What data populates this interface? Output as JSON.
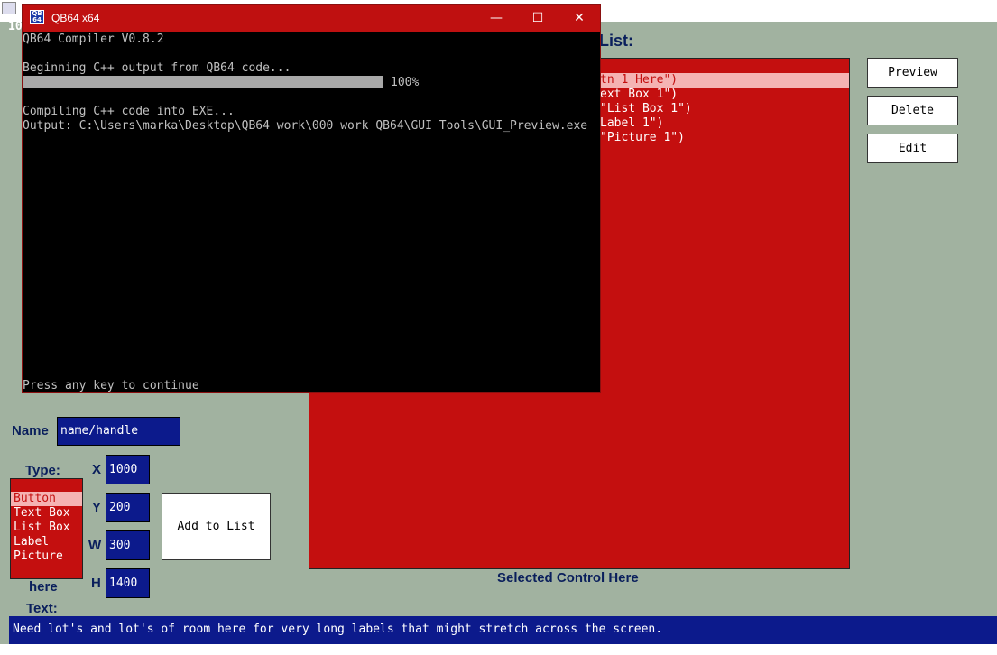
{
  "app": {
    "top_number": "10"
  },
  "designer": {
    "list_heading": "List:",
    "controls": [
      {
        "text": "tn 1 Here\")",
        "selected": true
      },
      {
        "text": "ext Box 1\")",
        "selected": false
      },
      {
        "text": "\"List Box 1\")",
        "selected": false
      },
      {
        "text": "Label 1\")",
        "selected": false
      },
      {
        "text": "\"Picture 1\")",
        "selected": false
      }
    ],
    "buttons": {
      "preview": "Preview",
      "delete": "Delete",
      "edit": "Edit",
      "add_to_list": "Add to List"
    },
    "selected_caption": "Selected Control Here",
    "name_label": "Name",
    "name_value": "name/handle",
    "type_label": "Type:",
    "types": [
      {
        "text": "Button",
        "selected": true
      },
      {
        "text": "Text Box",
        "selected": false
      },
      {
        "text": "List Box",
        "selected": false
      },
      {
        "text": "Label",
        "selected": false
      },
      {
        "text": "Picture",
        "selected": false
      }
    ],
    "x_label": "X",
    "x_value": "1000",
    "y_label": "Y",
    "y_value": "200",
    "w_label": "W",
    "w_value": "300",
    "h_label": "H",
    "h_value": "1400",
    "here_label": "here",
    "text_label": "Text:",
    "text_value": "Need lot's and lot's of room here for very long labels that might stretch across the screen."
  },
  "console": {
    "title": "QB64 x64",
    "icon_text": "QB 64",
    "lines": {
      "compiler": "QB64 Compiler V0.8.2",
      "beginning": "Beginning C++ output from QB64 code...",
      "progress_text": "100%",
      "compiling": "Compiling C++ code into EXE...",
      "output": "Output: C:\\Users\\marka\\Desktop\\QB64 work\\000 work QB64\\GUI Tools\\GUI_Preview.exe",
      "press": "Press any key to continue"
    },
    "progress": 1.0,
    "controls": {
      "minimize": "—",
      "maximize": "☐",
      "close": "✕"
    }
  }
}
